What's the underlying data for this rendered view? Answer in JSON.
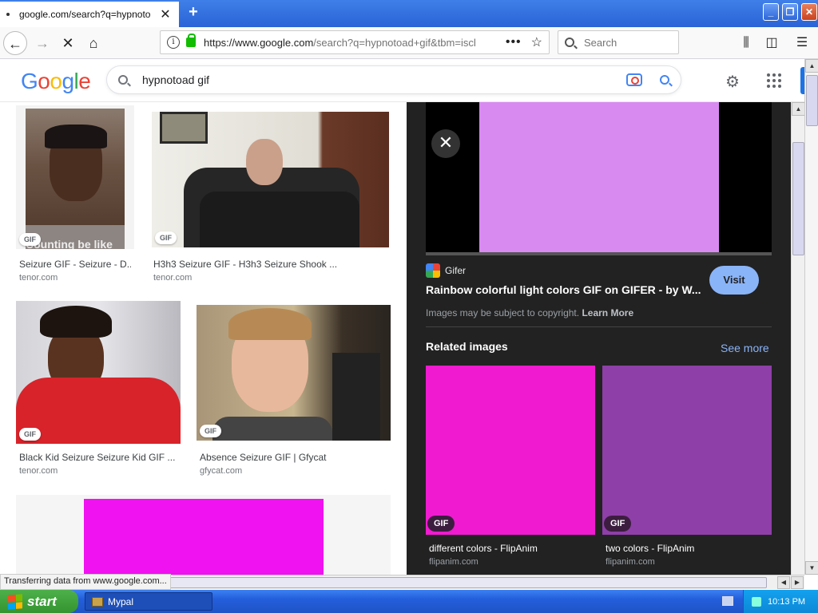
{
  "browser": {
    "tab_title": "google.com/search?q=hypnotoad+gif",
    "url_main": "https://www.google.com",
    "url_rest": "/search?q=hypnotoad+gif&tbm=isch",
    "search_placeholder": "Search",
    "status_text": "Transferring data from www.google.com..."
  },
  "google": {
    "query": "hypnotoad gif"
  },
  "results": [
    {
      "title": "Seizure GIF - Seizure - D...",
      "source": "tenor.com",
      "badge": "GIF",
      "overlay_text": "Counting be like"
    },
    {
      "title": "H3h3 Seizure GIF - H3h3 Seizure Shook ...",
      "source": "tenor.com",
      "badge": "GIF"
    },
    {
      "title": "Black Kid Seizure Seizure Kid GIF ...",
      "source": "tenor.com",
      "badge": "GIF"
    },
    {
      "title": "Absence Seizure GIF | Gfycat",
      "source": "gfycat.com",
      "badge": "GIF"
    }
  ],
  "panel": {
    "source_name": "Gifer",
    "title": "Rainbow colorful light colors GIF on GIFER - by W...",
    "visit_label": "Visit",
    "copyright_text": "Images may be subject to copyright.",
    "learn_more": "Learn More",
    "related_heading": "Related images",
    "see_more": "See more",
    "related": [
      {
        "title": "different colors - FlipAnim",
        "source": "flipanim.com",
        "badge": "GIF",
        "color": "#f01ad0"
      },
      {
        "title": "two colors - FlipAnim",
        "source": "flipanim.com",
        "badge": "GIF",
        "color": "#8e3fa8"
      }
    ],
    "preview_color": "#d98af1"
  },
  "taskbar": {
    "start_label": "start",
    "task_label": "Mypal",
    "clock": "10:13 PM"
  }
}
